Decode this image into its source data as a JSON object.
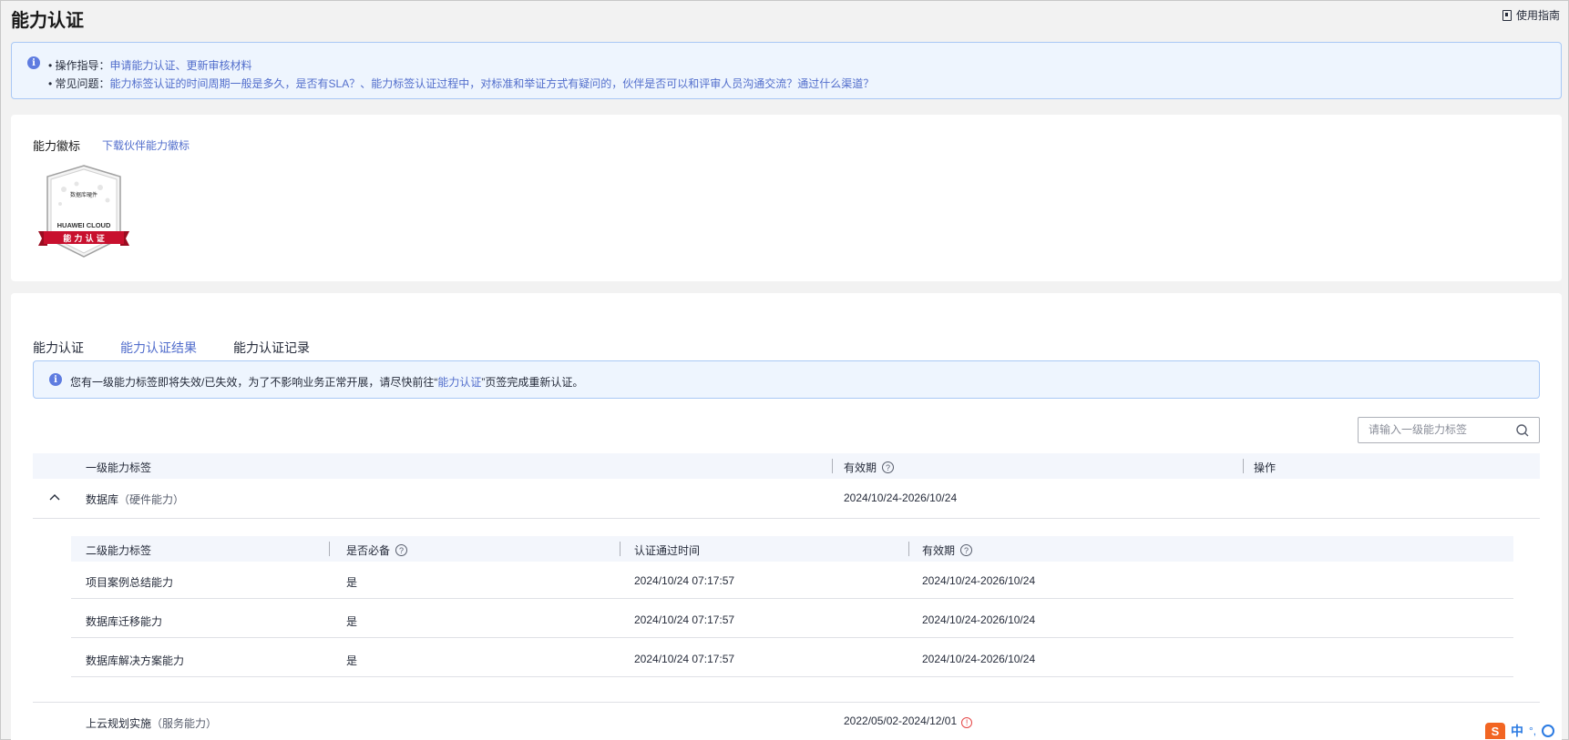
{
  "page": {
    "title": "能力认证",
    "guide_label": "使用指南"
  },
  "tips": {
    "line1_prefix": "• 操作指导：",
    "line1_links": "申请能力认证、更新审核材料",
    "line2_prefix": "• 常见问题：",
    "line2_links": "能力标签认证的时间周期一般是多久，是否有SLA？、能力标签认证过程中，对标准和举证方式有疑问的，伙伴是否可以和评审人员沟通交流？通过什么渠道？"
  },
  "badge": {
    "title": "能力徽标",
    "download_label": "下载伙伴能力徽标",
    "image_small_text": "数据库硬件",
    "image_brand": "HUAWEI CLOUD",
    "image_ribbon": "能 力 认 证"
  },
  "tabs": [
    {
      "label": "能力认证",
      "active": false
    },
    {
      "label": "能力认证结果",
      "active": true
    },
    {
      "label": "能力认证记录",
      "active": false
    }
  ],
  "warning": {
    "text_before": "您有一级能力标签即将失效/已失效，为了不影响业务正常开展，请尽快前往“",
    "link": "能力认证",
    "text_after": "”页签完成重新认证。"
  },
  "search": {
    "placeholder": "请输入一级能力标签",
    "value": ""
  },
  "table": {
    "headers": {
      "label": "一级能力标签",
      "validity": "有效期",
      "action": "操作"
    },
    "rows": [
      {
        "name": "数据库",
        "type": "（硬件能力）",
        "validity": "2024/10/24-2026/10/24",
        "expanded": true,
        "sub_headers": {
          "label": "二级能力标签",
          "required": "是否必备",
          "passed_time": "认证通过时间",
          "validity": "有效期"
        },
        "sub_rows": [
          {
            "label": "项目案例总结能力",
            "required": "是",
            "passed_time": "2024/10/24 07:17:57",
            "validity": "2024/10/24-2026/10/24"
          },
          {
            "label": "数据库迁移能力",
            "required": "是",
            "passed_time": "2024/10/24 07:17:57",
            "validity": "2024/10/24-2026/10/24"
          },
          {
            "label": "数据库解决方案能力",
            "required": "是",
            "passed_time": "2024/10/24 07:17:57",
            "validity": "2024/10/24-2026/10/24"
          }
        ]
      },
      {
        "name": "上云规划实施",
        "type": "（服务能力）",
        "validity": "2022/05/02-2024/12/01",
        "expanded": false
      }
    ]
  },
  "ime": {
    "logo": "S",
    "lang": "中",
    "dots": "°,"
  },
  "colors": {
    "accent": "#526ecc",
    "banner_bg": "#eef5fe",
    "banner_border": "#a9c8f5",
    "header_bg": "#f3f6fc",
    "warning": "#e54545",
    "badge_red": "#c8102e"
  }
}
